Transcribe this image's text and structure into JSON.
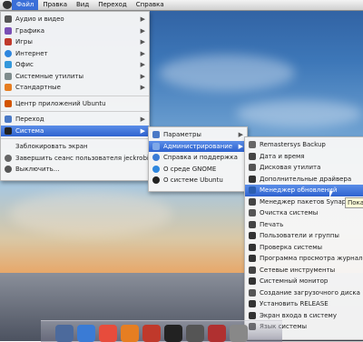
{
  "menubar": {
    "items": [
      {
        "label": "Файл"
      },
      {
        "label": "Правка"
      },
      {
        "label": "Вид"
      },
      {
        "label": "Переход"
      },
      {
        "label": "Справка"
      }
    ]
  },
  "apps_menu": {
    "items": [
      {
        "label": "Аудио и видео",
        "icon": "audio-video-icon",
        "color": "#555555",
        "arrow": true
      },
      {
        "label": "Графика",
        "icon": "graphics-icon",
        "color": "#7a4fb5",
        "arrow": true
      },
      {
        "label": "Игры",
        "icon": "games-icon",
        "color": "#c0392b",
        "arrow": true
      },
      {
        "label": "Интернет",
        "icon": "internet-icon",
        "color": "#2e86de",
        "arrow": true
      },
      {
        "label": "Офис",
        "icon": "office-icon",
        "color": "#3498db",
        "arrow": true
      },
      {
        "label": "Системные утилиты",
        "icon": "system-tools-icon",
        "color": "#7f8c8d",
        "arrow": true
      },
      {
        "label": "Стандартные",
        "icon": "accessories-icon",
        "color": "#e67e22",
        "arrow": true
      }
    ],
    "center_label": "Центр приложений Ubuntu",
    "go_label": "Переход",
    "system_label": "Система",
    "lock_label": "Заблокировать экран",
    "logout_label": "Завершить сеанс пользователя jeckrobinson...",
    "shutdown_label": "Выключить..."
  },
  "system_menu": {
    "params_label": "Параметры",
    "admin_label": "Администрирование",
    "help_label": "Справка и поддержка",
    "about_gnome_label": "О среде GNOME",
    "about_ubuntu_label": "О системе Ubuntu"
  },
  "admin_menu": {
    "items": [
      {
        "label": "Remastersys Backup",
        "icon": "backup-icon",
        "color": "#666666"
      },
      {
        "label": "Дата и время",
        "icon": "clock-icon",
        "color": "#444444"
      },
      {
        "label": "Дисковая утилита",
        "icon": "disk-icon",
        "color": "#555555"
      },
      {
        "label": "Дополнительные драйвера",
        "icon": "driver-icon",
        "color": "#333333"
      },
      {
        "label": "Менеджер обновлений",
        "icon": "update-icon",
        "color": "#2a5db0",
        "selected": true
      },
      {
        "label": "Менеджер пакетов Synaptic",
        "icon": "synaptic-icon",
        "color": "#444444"
      },
      {
        "label": "Очистка системы",
        "icon": "cleanup-icon",
        "color": "#555555"
      },
      {
        "label": "Печать",
        "icon": "printer-icon",
        "color": "#444444"
      },
      {
        "label": "Пользователи и группы",
        "icon": "users-icon",
        "color": "#333333"
      },
      {
        "label": "Проверка системы",
        "icon": "check-icon",
        "color": "#333333"
      },
      {
        "label": "Программа просмотра журналов",
        "icon": "log-icon",
        "color": "#333333"
      },
      {
        "label": "Сетевые инструменты",
        "icon": "network-icon",
        "color": "#444444"
      },
      {
        "label": "Системный монитор",
        "icon": "monitor-icon",
        "color": "#333333"
      },
      {
        "label": "Создание загрузочного диска",
        "icon": "usb-icon",
        "color": "#555555"
      },
      {
        "label": "Установить RELEASE",
        "icon": "install-icon",
        "color": "#333333"
      },
      {
        "label": "Экран входа в систему",
        "icon": "login-screen-icon",
        "color": "#333333"
      },
      {
        "label": "Язык системы",
        "icon": "language-icon",
        "color": "#333333"
      }
    ]
  },
  "tooltip": "Показ",
  "dock": {
    "items": [
      {
        "icon": "anchor-icon",
        "color": "#4c6a9c"
      },
      {
        "icon": "finder-icon",
        "color": "#3a7bd5"
      },
      {
        "icon": "chrome-icon",
        "color": "#e74c3c"
      },
      {
        "icon": "firefox-icon",
        "color": "#e67e22"
      },
      {
        "icon": "opera-icon",
        "color": "#c0392b"
      },
      {
        "icon": "terminal-icon",
        "color": "#222222"
      },
      {
        "icon": "screenshot-icon",
        "color": "#555555"
      },
      {
        "icon": "app-icon",
        "color": "#b03030"
      },
      {
        "icon": "trash-icon",
        "color": "#888888"
      }
    ]
  }
}
